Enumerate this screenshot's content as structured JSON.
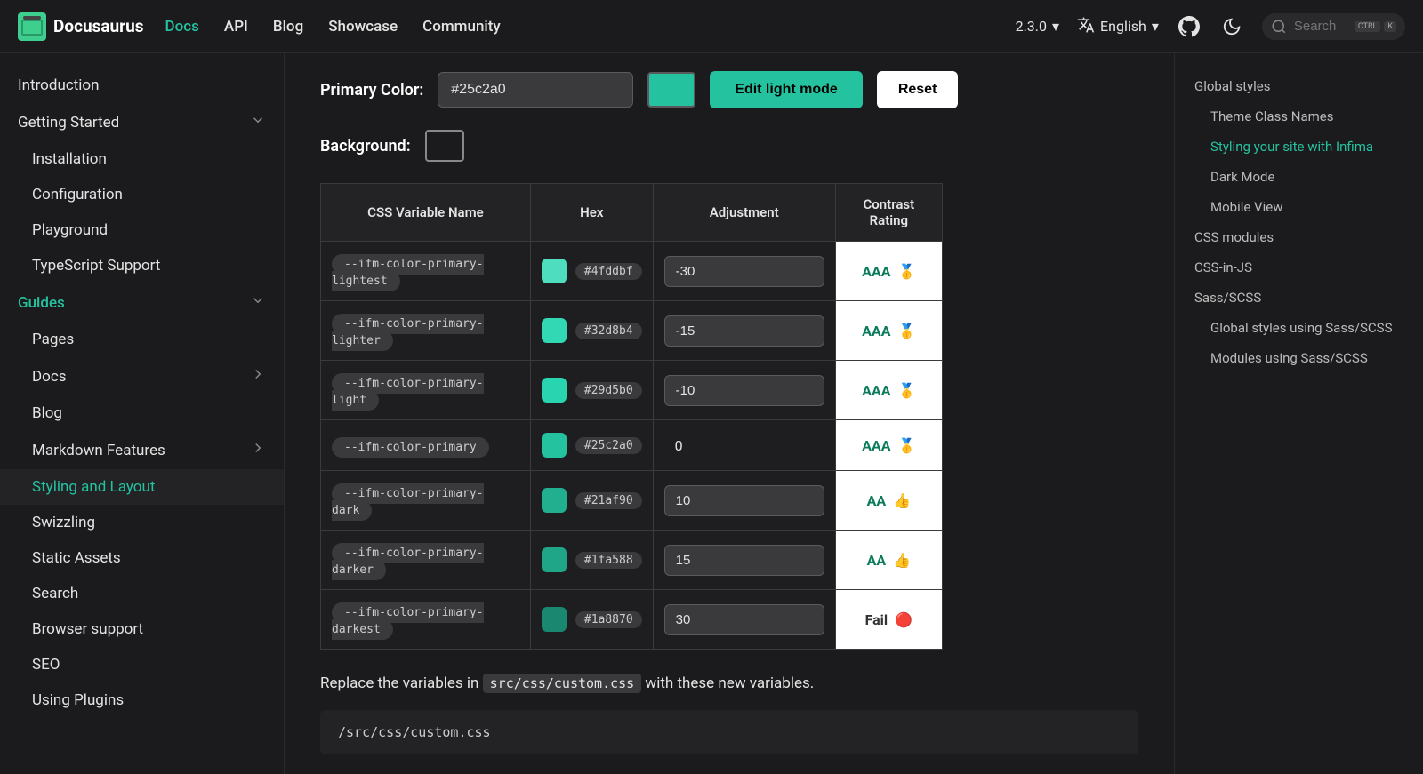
{
  "brand": "Docusaurus",
  "nav": {
    "links": [
      "Docs",
      "API",
      "Blog",
      "Showcase",
      "Community"
    ],
    "active": "Docs",
    "version": "2.3.0",
    "language": "English",
    "search_placeholder": "Search",
    "kbd": [
      "CTRL",
      "K"
    ]
  },
  "sidebar": [
    {
      "label": "Introduction",
      "nested": false
    },
    {
      "label": "Getting Started",
      "nested": false,
      "expandable": true,
      "expanded": true
    },
    {
      "label": "Installation",
      "nested": true
    },
    {
      "label": "Configuration",
      "nested": true
    },
    {
      "label": "Playground",
      "nested": true
    },
    {
      "label": "TypeScript Support",
      "nested": true
    },
    {
      "label": "Guides",
      "nested": false,
      "category": true,
      "expandable": true,
      "expanded": true
    },
    {
      "label": "Pages",
      "nested": true
    },
    {
      "label": "Docs",
      "nested": true,
      "submenu": true
    },
    {
      "label": "Blog",
      "nested": true
    },
    {
      "label": "Markdown Features",
      "nested": true,
      "submenu": true
    },
    {
      "label": "Styling and Layout",
      "nested": true,
      "active": true
    },
    {
      "label": "Swizzling",
      "nested": true
    },
    {
      "label": "Static Assets",
      "nested": true
    },
    {
      "label": "Search",
      "nested": true
    },
    {
      "label": "Browser support",
      "nested": true
    },
    {
      "label": "SEO",
      "nested": true
    },
    {
      "label": "Using Plugins",
      "nested": true
    }
  ],
  "form": {
    "primary_label": "Primary Color:",
    "primary_value": "#25c2a0",
    "swatch_color": "#25c2a0",
    "edit_button": "Edit light mode",
    "reset_button": "Reset",
    "background_label": "Background:",
    "background_color": "#1b1b1d"
  },
  "table": {
    "headers": [
      "CSS Variable Name",
      "Hex",
      "Adjustment",
      "Contrast Rating"
    ],
    "rows": [
      {
        "var": "--ifm-color-primary-lightest",
        "hex": "#4fddbf",
        "color": "#4fddbf",
        "adj": "-30",
        "adj_editable": true,
        "rating": "AAA",
        "icon": "🥇"
      },
      {
        "var": "--ifm-color-primary-lighter",
        "hex": "#32d8b4",
        "color": "#32d8b4",
        "adj": "-15",
        "adj_editable": true,
        "rating": "AAA",
        "icon": "🥇"
      },
      {
        "var": "--ifm-color-primary-light",
        "hex": "#29d5b0",
        "color": "#29d5b0",
        "adj": "-10",
        "adj_editable": true,
        "rating": "AAA",
        "icon": "🥇"
      },
      {
        "var": "--ifm-color-primary",
        "hex": "#25c2a0",
        "color": "#25c2a0",
        "adj": "0",
        "adj_editable": false,
        "rating": "AAA",
        "icon": "🥇"
      },
      {
        "var": "--ifm-color-primary-dark",
        "hex": "#21af90",
        "color": "#21af90",
        "adj": "10",
        "adj_editable": true,
        "rating": "AA",
        "icon": "👍"
      },
      {
        "var": "--ifm-color-primary-darker",
        "hex": "#1fa588",
        "color": "#1fa588",
        "adj": "15",
        "adj_editable": true,
        "rating": "AA",
        "icon": "👍"
      },
      {
        "var": "--ifm-color-primary-darkest",
        "hex": "#1a8870",
        "color": "#1a8870",
        "adj": "30",
        "adj_editable": true,
        "rating": "Fail",
        "icon": "🔴",
        "fail": true
      }
    ]
  },
  "description": {
    "prefix": "Replace the variables in ",
    "code": "src/css/custom.css",
    "suffix": " with these new variables."
  },
  "codeblock_title": "/src/css/custom.css",
  "toc": [
    {
      "label": "Global styles",
      "nested": false
    },
    {
      "label": "Theme Class Names",
      "nested": true
    },
    {
      "label": "Styling your site with Infima",
      "nested": true,
      "active": true
    },
    {
      "label": "Dark Mode",
      "nested": true
    },
    {
      "label": "Mobile View",
      "nested": true
    },
    {
      "label": "CSS modules",
      "nested": false
    },
    {
      "label": "CSS-in-JS",
      "nested": false
    },
    {
      "label": "Sass/SCSS",
      "nested": false
    },
    {
      "label": "Global styles using Sass/SCSS",
      "nested": true
    },
    {
      "label": "Modules using Sass/SCSS",
      "nested": true
    }
  ]
}
